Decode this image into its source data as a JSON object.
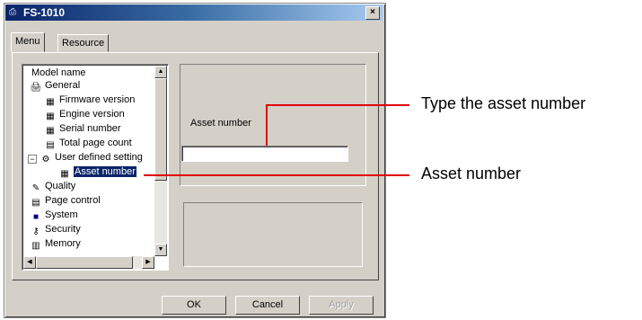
{
  "window": {
    "title": "FS-1010",
    "close_label": "×"
  },
  "tabs": [
    {
      "label": "Menu"
    },
    {
      "label": "Resource"
    }
  ],
  "tree": {
    "items": [
      {
        "label": "Model name"
      },
      {
        "label": "General"
      },
      {
        "label": "Firmware version"
      },
      {
        "label": "Engine version"
      },
      {
        "label": "Serial number"
      },
      {
        "label": "Total page count"
      },
      {
        "label": "User defined setting"
      },
      {
        "label": "Asset number"
      },
      {
        "label": "Quality"
      },
      {
        "label": "Page control"
      },
      {
        "label": "System"
      },
      {
        "label": "Security"
      },
      {
        "label": "Memory"
      }
    ]
  },
  "field": {
    "label": "Asset number",
    "value": ""
  },
  "buttons": {
    "ok": "OK",
    "cancel": "Cancel",
    "apply": "Apply"
  },
  "callouts": {
    "type_asset": "Type the asset number",
    "asset_number": "Asset number"
  },
  "colors": {
    "callout_line": "#e00000",
    "titlebar": "#0a246a"
  }
}
